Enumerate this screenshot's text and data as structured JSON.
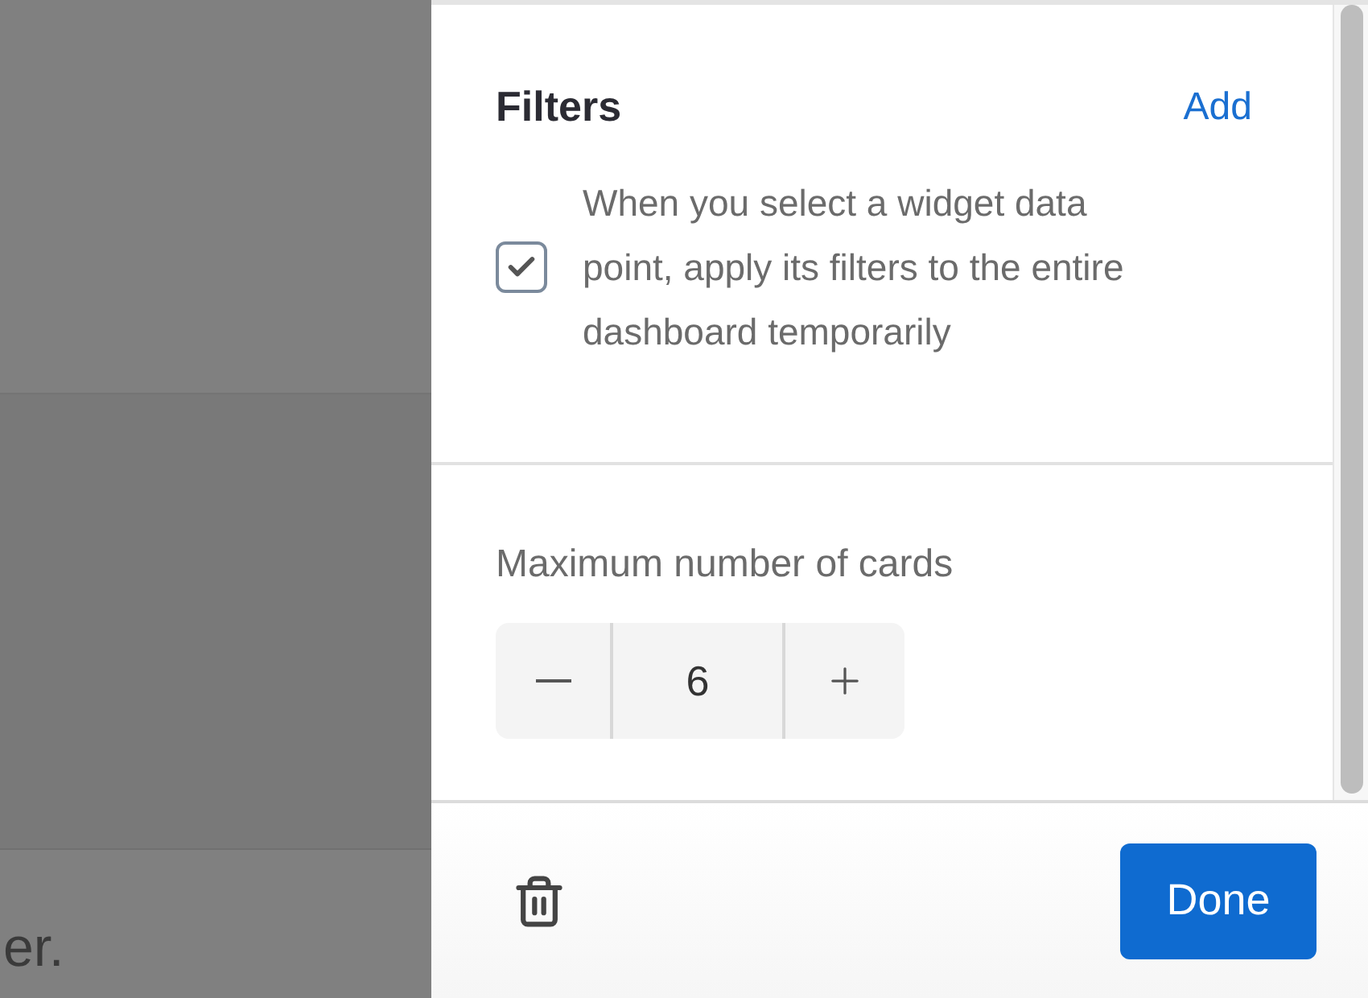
{
  "background": {
    "footer_text": "er."
  },
  "filters": {
    "title": "Filters",
    "add_link": "Add",
    "apply_option": {
      "label": "When you select a widget data point, apply its filters to the entire dashboard temporarily",
      "checked": true
    }
  },
  "max_cards": {
    "label": "Maximum number of cards",
    "value": "6"
  },
  "footer": {
    "done_button": "Done"
  }
}
